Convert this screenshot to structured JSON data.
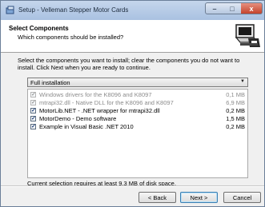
{
  "window": {
    "title": "Setup - Velleman Stepper Motor Cards",
    "controls": {
      "minimize": "–",
      "maximize": "□",
      "close": "x"
    }
  },
  "header": {
    "title": "Select Components",
    "subtitle": "Which components should be installed?",
    "icon": "installer-computer-icon"
  },
  "instructions": "Select the components you want to install; clear the components you do not want to install. Click Next when you are ready to continue.",
  "install_type": {
    "selected": "Full installation",
    "arrow": "▼"
  },
  "components": [
    {
      "label": "Windows drivers for the K8096 and K8097",
      "size": "0,1 MB",
      "checked": true,
      "enabled": false
    },
    {
      "label": "mtrapi32.dll - Native DLL for the K8096 and K8097",
      "size": "6,9 MB",
      "checked": true,
      "enabled": false
    },
    {
      "label": "MotorLib.NET - .NET wrapper for mtrapi32.dll",
      "size": "0,2 MB",
      "checked": true,
      "enabled": true
    },
    {
      "label": "MotorDemo - Demo software",
      "size": "1,5 MB",
      "checked": true,
      "enabled": true
    },
    {
      "label": "Example in Visual Basic .NET 2010",
      "size": "0,2 MB",
      "checked": true,
      "enabled": true
    }
  ],
  "checkmark": "✓",
  "disk_space": "Current selection requires at least 9,3 MB of disk space.",
  "buttons": {
    "back": "< Back",
    "next": "Next >",
    "cancel": "Cancel"
  }
}
